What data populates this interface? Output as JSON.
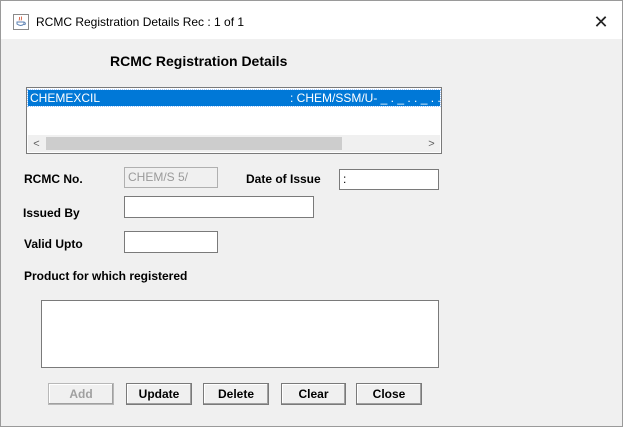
{
  "window": {
    "title": "RCMC Registration Details  Rec : 1 of 1",
    "close_label": "✕"
  },
  "heading": "RCMC Registration  Details",
  "list": {
    "rows": [
      {
        "col1": "CHEMEXCIL",
        "col2": ": CHEM/SSM/U- _ . _ . . _ . ."
      }
    ],
    "scroll_left": "<",
    "scroll_right": ">"
  },
  "form": {
    "rcmc_no_label": "RCMC No.",
    "rcmc_no_value": "CHEM/S      5/",
    "date_of_issue_label": "Date of Issue",
    "date_of_issue_value": ":",
    "issued_by_label": "Issued By",
    "issued_by_value": "",
    "valid_upto_label": "Valid Upto",
    "valid_upto_value": "",
    "product_label": "Product for which registered",
    "product_value": ""
  },
  "buttons": {
    "add": "Add",
    "update": "Update",
    "delete": "Delete",
    "clear": "Clear",
    "close": "Close"
  },
  "colors": {
    "selection": "#0078d7",
    "window_bg": "#f0f0f0"
  }
}
